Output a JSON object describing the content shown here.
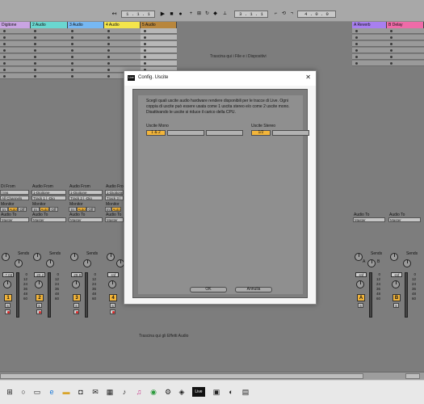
{
  "transport": {
    "position": "1 .   1 .   1",
    "loop_start": "3 .   1 .   1",
    "loop_length": "4 .   0 .   0",
    "icons": [
      "back-arrow-icon",
      "play-icon",
      "stop-icon",
      "record-icon",
      "loop-icon",
      "punch-icon"
    ]
  },
  "tracks": [
    {
      "name": "Digitone",
      "color": "#c9a4e2"
    },
    {
      "name": "2 Audio",
      "color": "#6ad7d0"
    },
    {
      "name": "3 Audio",
      "color": "#76b8f3"
    },
    {
      "name": "4 Audio",
      "color": "#f4e54b"
    },
    {
      "name": "5 Audio",
      "color": "#b8863c"
    },
    {
      "name": "A Reverb",
      "color": "#a87ff0"
    },
    {
      "name": "B Delay",
      "color": "#ee6ba8"
    }
  ],
  "drop_files": "Trascina qui i File e i Dispositivi",
  "drop_effects": "Trascina qui gli Effetti Audio",
  "mixer": {
    "strip1": {
      "input_label": "Di From",
      "input": "l Ins",
      "channel": "All Channels",
      "monitor_label": "Monitor",
      "monitor": [
        "In",
        "Auto",
        "Off"
      ],
      "audio_to_label": "Audio To",
      "audio_to": "Master",
      "volume": "-7.03",
      "number": "1"
    },
    "strip2": {
      "input_label": "Audio From",
      "input": "1-Digitone",
      "channel": "Track 1 | -Dig",
      "monitor_label": "Monitor",
      "monitor": [
        "In",
        "Auto",
        "Off"
      ],
      "audio_to_label": "Audio To",
      "audio_to": "Master",
      "volume": "-20.2",
      "number": "2"
    },
    "strip3": {
      "input_label": "Audio From",
      "input": "1-Digitone",
      "channel": "Track 2 | -Dig",
      "monitor_label": "Monitor",
      "monitor": [
        "In",
        "Auto",
        "Off"
      ],
      "audio_to_label": "Audio To",
      "audio_to": "Master",
      "volume": "-29.8",
      "number": "3"
    },
    "strip4": {
      "input_label": "Audio From",
      "input": "1-Digitone",
      "channel": "Track 3 |",
      "monitor_label": "Monitor",
      "monitor": [
        "In",
        "Auto",
        "Off"
      ],
      "audio_to_label": "Audio To",
      "audio_to": "Master",
      "volume": "-Inf",
      "number": "4"
    },
    "stripA": {
      "audio_to_label": "Audio To",
      "audio_to": "Master",
      "volume": "-Inf",
      "number": "A"
    },
    "stripB": {
      "audio_to_label": "Audio To",
      "audio_to": "Master",
      "volume": "-Inf",
      "number": "B"
    },
    "sends_label": "Sends",
    "send_letters": [
      "A",
      "B"
    ],
    "scale": [
      "0",
      "12",
      "24",
      "36",
      "48",
      "60"
    ],
    "solo_label": "S"
  },
  "dialog": {
    "title": "Config. Uscite",
    "logo": "Live",
    "description": "Scegli quali uscite audio hardware rendere disponibili per le tracce di Live. Ogni coppia di uscite può essere usata come 1 uscita stereo e/o come 2 uscite mono. Disattivando le uscite si riduce il carico della CPU.",
    "mono_label": "Uscite Mono",
    "stereo_label": "Uscite Stereo",
    "mono_outputs": [
      "1 & 2",
      "",
      ""
    ],
    "stereo_outputs": [
      "1/2",
      ""
    ],
    "ok": "OK",
    "cancel": "Annulla"
  },
  "taskbar_icons": [
    "windows-start-icon",
    "search-icon",
    "task-view-icon",
    "edge-icon",
    "file-explorer-icon",
    "store-icon",
    "mail-icon",
    "ableton-icon",
    "itunes-icon",
    "chrome-icon",
    "steam-icon",
    "live-icon",
    "app-icon",
    "app2-icon",
    "app3-icon"
  ],
  "taskbar_live": "Live"
}
